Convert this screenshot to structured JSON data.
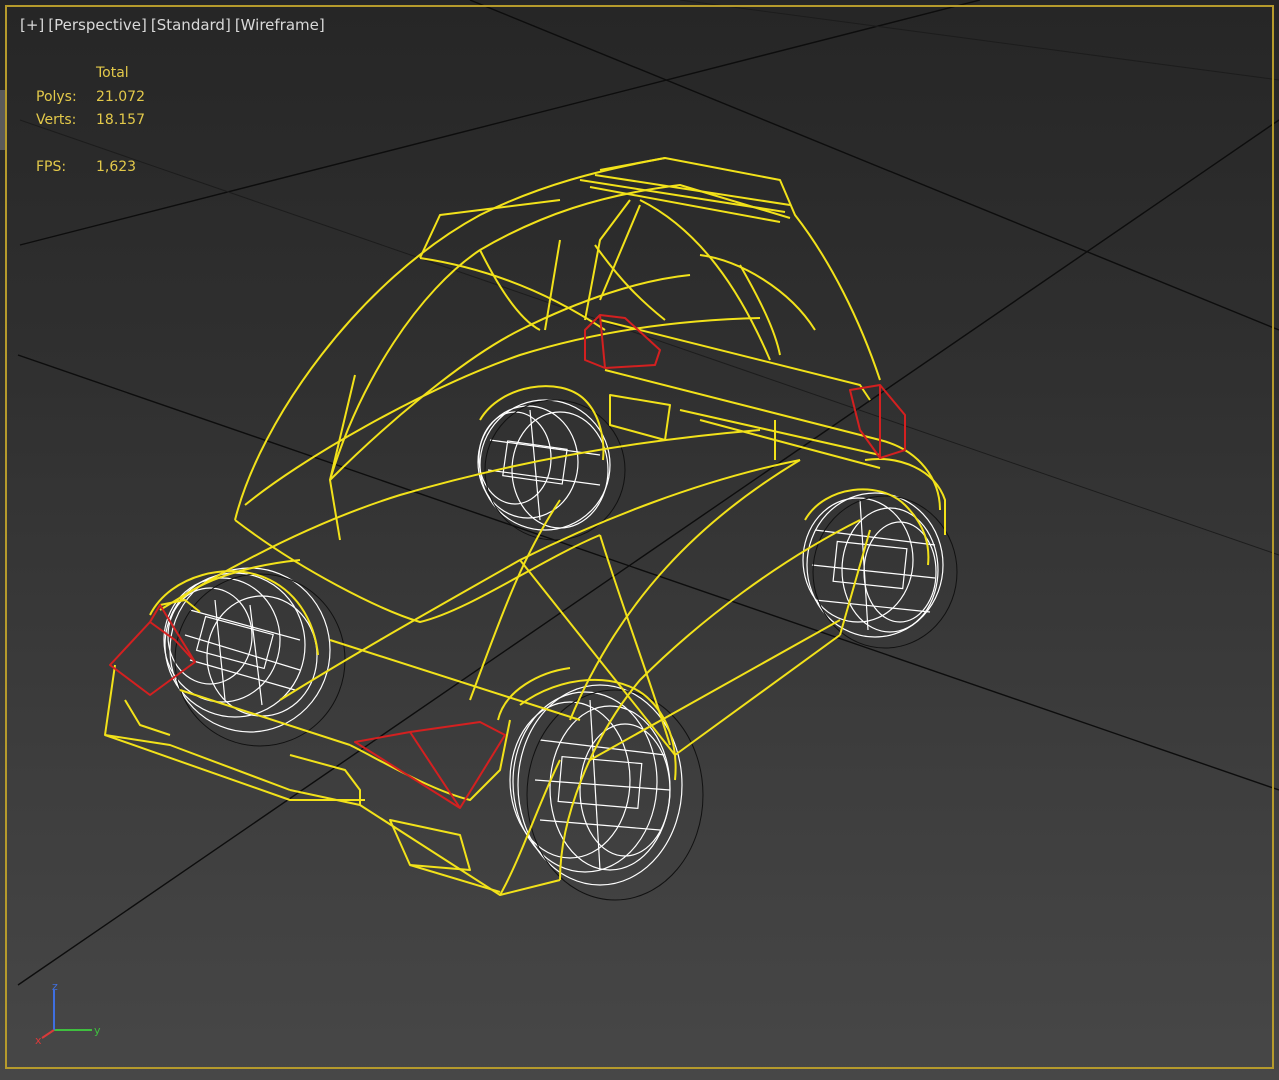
{
  "viewport": {
    "labels": {
      "plus": "[+]",
      "view": "[Perspective]",
      "shading_mode": "[Standard]",
      "display_mode": "[Wireframe]"
    },
    "stats": {
      "header": "Total",
      "polys_label": "Polys:",
      "polys_value": "21.072",
      "verts_label": "Verts:",
      "verts_value": "18.157",
      "fps_label": "FPS:",
      "fps_value": "1,623"
    },
    "gizmo": {
      "x_label": "x",
      "y_label": "y",
      "z_label": "z"
    },
    "colors": {
      "wireframe": "#f2e21a",
      "selected_edges": "#d42020",
      "wheels": "#ffffff",
      "grid": "#0d0d0d",
      "stats_text": "#e3c94a",
      "border": "#b59a2c"
    },
    "icons": {
      "gizmo": "axis-tripod-icon"
    }
  }
}
